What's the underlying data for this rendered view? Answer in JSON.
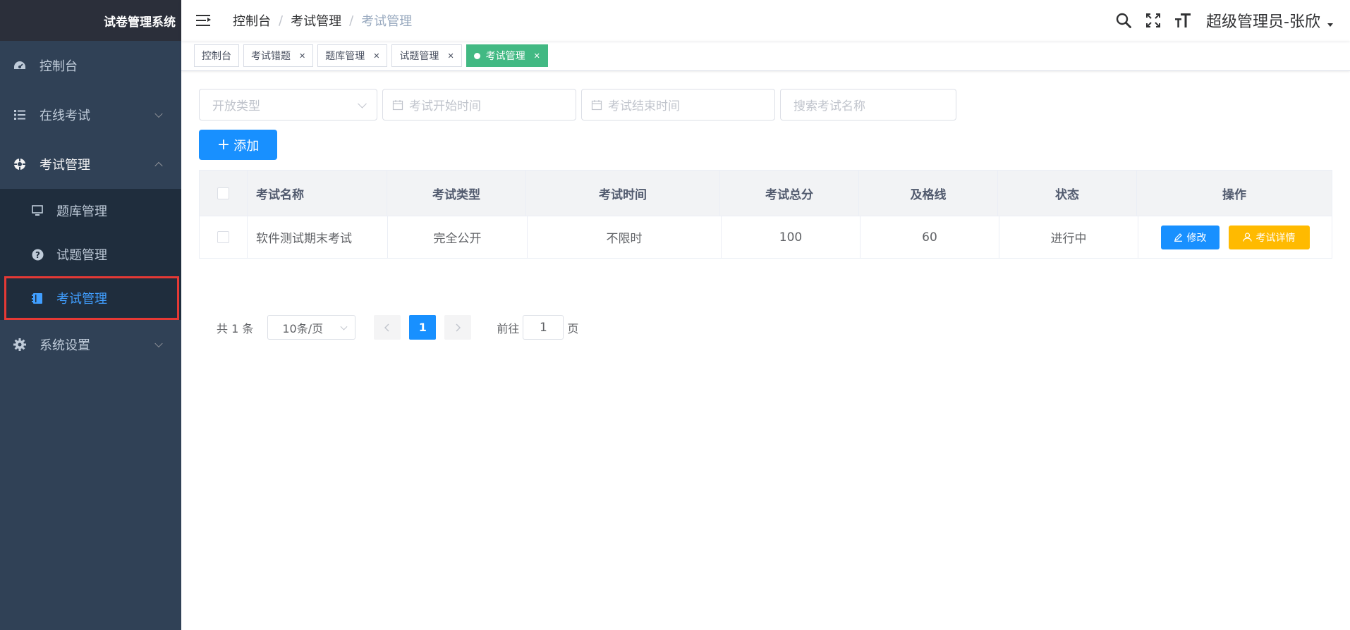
{
  "app": {
    "title": "试卷管理系统"
  },
  "sidebar": {
    "items": [
      {
        "label": "控制台",
        "icon": "dashboard-icon"
      },
      {
        "label": "在线考试",
        "icon": "list-icon"
      },
      {
        "label": "考试管理",
        "icon": "exam-icon"
      },
      {
        "label": "系统设置",
        "icon": "gear-icon"
      }
    ],
    "submenu": [
      {
        "label": "题库管理",
        "icon": "monitor-icon"
      },
      {
        "label": "试题管理",
        "icon": "question-icon"
      },
      {
        "label": "考试管理",
        "icon": "book-icon",
        "active": true
      }
    ]
  },
  "header": {
    "breadcrumb": [
      "控制台",
      "考试管理",
      "考试管理"
    ],
    "separator": "/",
    "user": "超级管理员-张欣"
  },
  "tags": [
    {
      "label": "控制台"
    },
    {
      "label": "考试错题"
    },
    {
      "label": "题库管理"
    },
    {
      "label": "试题管理"
    },
    {
      "label": "考试管理",
      "active": true
    }
  ],
  "filters": {
    "type_placeholder": "开放类型",
    "start_placeholder": "考试开始时间",
    "end_placeholder": "考试结束时间",
    "search_placeholder": "搜索考试名称"
  },
  "toolbar": {
    "add_label": "添加"
  },
  "table": {
    "headers": [
      "考试名称",
      "考试类型",
      "考试时间",
      "考试总分",
      "及格线",
      "状态",
      "操作"
    ],
    "rows": [
      {
        "name": "软件测试期末考试",
        "type": "完全公开",
        "time": "不限时",
        "total": "100",
        "pass": "60",
        "status": "进行中"
      }
    ],
    "edit_label": "修改",
    "detail_label": "考试详情"
  },
  "pagination": {
    "total_text": "共 1 条",
    "page_size": "10条/页",
    "current": "1",
    "goto_prefix": "前往",
    "goto_value": "1",
    "goto_suffix": "页"
  },
  "colors": {
    "primary": "#1890ff",
    "tag_active": "#42b983",
    "warning": "#ffba00",
    "sidebar_bg": "#304156"
  }
}
